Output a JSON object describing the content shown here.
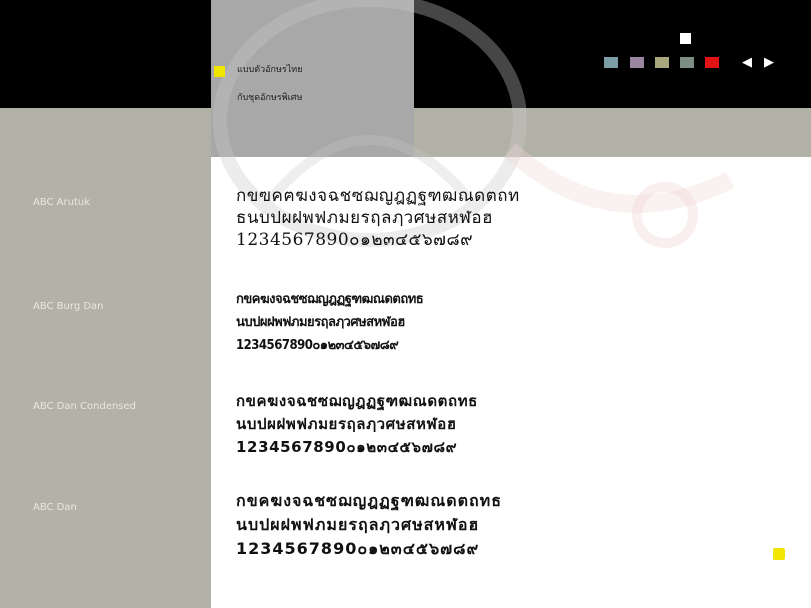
{
  "header": {
    "title_line1": "แบบตัวอักษรไทย",
    "title_line2": "กับชุดอักษรพิเศษ",
    "nav_prev_label": "◀",
    "nav_next_label": "▶"
  },
  "colors": {
    "accent_yellow": "#f0e600",
    "swatches": [
      "#7c9ca6",
      "#9a86a0",
      "#a8a87c",
      "#7e8e84",
      "#e01414"
    ],
    "selected_swatch": "#ffffff"
  },
  "fonts": [
    {
      "name": "ABC Arutuk",
      "lines": [
        "กขฃคฅฆงจฉชซฌญฎฏฐฑฒณดตถท",
        "ธนบปผฝพฟภมยรฤลฦวศษสหฬอฮ",
        "1234567890๐๑๒๓๔๕๖๗๘๙"
      ]
    },
    {
      "name": "ABC Burg Dan",
      "lines": [
        "กขคฆงจฉชซฌญฎฏฐฑฒณดตถทธ",
        "นบปผฝพฟภมยรฤลฦวศษสหฬอฮ",
        "1234567890๐๑๒๓๔๕๖๗๘๙"
      ]
    },
    {
      "name": "ABC Dan Condensed",
      "lines": [
        "กขคฆงจฉชซฌญฎฏฐฑฒณดตถทธ",
        "นบปผฝพฟภมยรฤลฦวศษสหฬอฮ",
        "1234567890๐๑๒๓๔๕๖๗๘๙"
      ]
    },
    {
      "name": "ABC Dan",
      "lines": [
        "กขคฆงจฉชซฌญฎฏฐฑฒณดตถทธ",
        "นบปผฝพฟภมยรฤลฦวศษสหฬอฮ",
        "1234567890๐๑๒๓๔๕๖๗๘๙"
      ]
    }
  ]
}
